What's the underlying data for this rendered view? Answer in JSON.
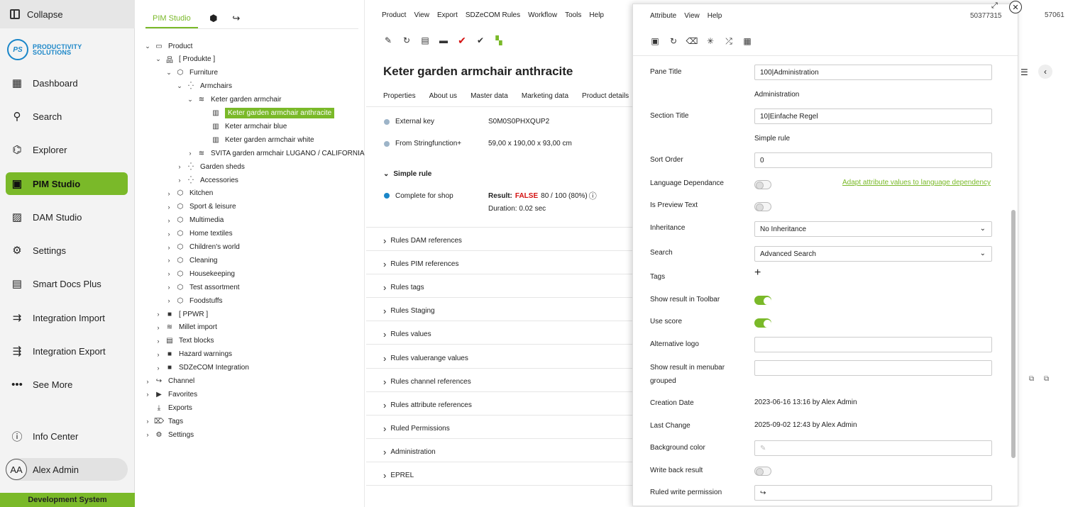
{
  "sidebar": {
    "collapse": "Collapse",
    "logo_ps": "PS",
    "logo_line1": "PRODUCTIVITY",
    "logo_line2": "SOLUTIONS",
    "items": [
      {
        "label": "Dashboard",
        "icon": "dashboard-icon",
        "glyph": "▦"
      },
      {
        "label": "Search",
        "icon": "search-icon",
        "glyph": "⚲"
      },
      {
        "label": "Explorer",
        "icon": "explorer-icon",
        "glyph": "⌬"
      },
      {
        "label": "PIM Studio",
        "icon": "pim-studio-icon",
        "glyph": "▣"
      },
      {
        "label": "DAM Studio",
        "icon": "image-icon",
        "glyph": "▨"
      },
      {
        "label": "Settings",
        "icon": "gear-icon",
        "glyph": "⚙"
      },
      {
        "label": "Smart Docs Plus",
        "icon": "document-icon",
        "glyph": "▤"
      },
      {
        "label": "Integration Import",
        "icon": "import-icon",
        "glyph": "⇉"
      },
      {
        "label": "Integration Export",
        "icon": "export-icon",
        "glyph": "⇶"
      },
      {
        "label": "See More",
        "icon": "more-icon",
        "glyph": "•••"
      },
      {
        "label": "Info Center",
        "icon": "info-icon",
        "glyph": "ⓘ"
      }
    ],
    "user_initials": "AA",
    "user_name": "Alex Admin",
    "environment": "Development System"
  },
  "tree": {
    "tab": "PIM Studio",
    "nodes": [
      {
        "label": "Product",
        "chevron": "⌄",
        "icon": "▭"
      },
      {
        "label": "[ Produkte ]",
        "chevron": "⌄",
        "icon": "品"
      },
      {
        "label": "Furniture",
        "chevron": "⌄",
        "icon": "⬡"
      },
      {
        "label": "Armchairs",
        "chevron": "⌄",
        "icon": "⁛"
      },
      {
        "label": "Keter garden armchair",
        "chevron": "⌄",
        "icon": "≋"
      },
      {
        "label": "Keter garden armchair anthracite",
        "chevron": "",
        "icon": "▥"
      },
      {
        "label": "Keter armchair blue",
        "chevron": "",
        "icon": "▥"
      },
      {
        "label": "Keter garden armchair white",
        "chevron": "",
        "icon": "▥"
      },
      {
        "label": "SVITA garden armchair LUGANO / CALIFORNIA",
        "chevron": "›",
        "icon": "≋"
      },
      {
        "label": "Garden sheds",
        "chevron": "›",
        "icon": "⁛"
      },
      {
        "label": "Accessories",
        "chevron": "›",
        "icon": "⁛"
      },
      {
        "label": "Kitchen",
        "chevron": "›",
        "icon": "⬡"
      },
      {
        "label": "Sport & leisure",
        "chevron": "›",
        "icon": "⬡"
      },
      {
        "label": "Multimedia",
        "chevron": "›",
        "icon": "⬡"
      },
      {
        "label": "Home textiles",
        "chevron": "›",
        "icon": "⬡"
      },
      {
        "label": "Children's world",
        "chevron": "›",
        "icon": "⬡"
      },
      {
        "label": "Cleaning",
        "chevron": "›",
        "icon": "⬡"
      },
      {
        "label": "Housekeeping",
        "chevron": "›",
        "icon": "⬡"
      },
      {
        "label": "Test assortment",
        "chevron": "›",
        "icon": "⬡"
      },
      {
        "label": "Foodstuffs",
        "chevron": "›",
        "icon": "⬡"
      },
      {
        "label": "[ PPWR ]",
        "chevron": "›",
        "icon": "■"
      },
      {
        "label": "Millet import",
        "chevron": "›",
        "icon": "≋"
      },
      {
        "label": "Text blocks",
        "chevron": "›",
        "icon": "▤"
      },
      {
        "label": "Hazard warnings",
        "chevron": "›",
        "icon": "■"
      },
      {
        "label": "SDZeCOM Integration",
        "chevron": "›",
        "icon": "■"
      },
      {
        "label": "Channel",
        "chevron": "›",
        "icon": "↪"
      },
      {
        "label": "Favorites",
        "chevron": "›",
        "icon": "▶"
      },
      {
        "label": "Exports",
        "chevron": "",
        "icon": "⤓"
      },
      {
        "label": "Tags",
        "chevron": "›",
        "icon": "⌦"
      },
      {
        "label": "Settings",
        "chevron": "›",
        "icon": "⚙"
      }
    ]
  },
  "menu": [
    "Product",
    "View",
    "Export",
    "SDZeCOM Rules",
    "Workflow",
    "Tools",
    "Help"
  ],
  "product": {
    "title": "Keter garden armchair anthracite",
    "tabs": [
      "Properties",
      "About us",
      "Master data",
      "Marketing data",
      "Product details"
    ],
    "fields": [
      {
        "label": "External key",
        "value": "S0M0S0PHXQUP2"
      },
      {
        "label": "From Stringfunction+",
        "value": "59,00 x 190,00 x 93,00 cm"
      }
    ],
    "simple_rule": "Simple rule",
    "complete_label": "Complete for shop",
    "result_label": "Result:",
    "result_false": "FALSE",
    "result_value": "80 / 100 (80%)",
    "duration": "Duration: 0.02 sec",
    "sections": [
      "Rules DAM references",
      "Rules PIM references",
      "Rules tags",
      "Rules Staging",
      "Rules values",
      "Rules valuerange values",
      "Rules channel references",
      "Rules attribute references",
      "Ruled Permissions",
      "Administration",
      "EPREL"
    ]
  },
  "panel": {
    "menu": [
      "Attribute",
      "View",
      "Help"
    ],
    "id": "50377315",
    "outside_id": "57061",
    "pane_title_label": "Pane Title",
    "pane_title_value": "100|Administration",
    "pane_title_sub": "Administration",
    "section_title_label": "Section Title",
    "section_title_value": "10|Einfache Regel",
    "section_title_sub": "Simple rule",
    "sort_order_label": "Sort Order",
    "sort_order_value": "0",
    "language_label": "Language Dependance",
    "language_link": "Adapt attribute values to language dependency",
    "preview_label": "Is Preview Text",
    "inheritance_label": "Inheritance",
    "inheritance_value": "No Inheritance",
    "search_label": "Search",
    "search_value": "Advanced Search",
    "tags_label": "Tags",
    "show_toolbar_label": "Show result in Toolbar",
    "use_score_label": "Use score",
    "alt_logo_label": "Alternative logo",
    "menubar_label_1": "Show result in menubar",
    "menubar_label_2": "grouped",
    "creation_label": "Creation Date",
    "creation_value": "2023-06-16 13:16 by Alex Admin",
    "last_change_label": "Last Change",
    "last_change_value": "2025-09-02 12:43 by Alex Admin",
    "bg_color_label": "Background color",
    "write_back_label": "Write back result",
    "ruled_write_label": "Ruled write permission",
    "toggles": {
      "language": false,
      "preview": false,
      "show_toolbar": true,
      "use_score": true,
      "write_back": false
    }
  },
  "colors": {
    "accent": "#7ab929",
    "false": "#d41010",
    "link": "#7ab929",
    "dot_grey": "#8fa8c0",
    "dot_blue": "#1a86c8"
  }
}
